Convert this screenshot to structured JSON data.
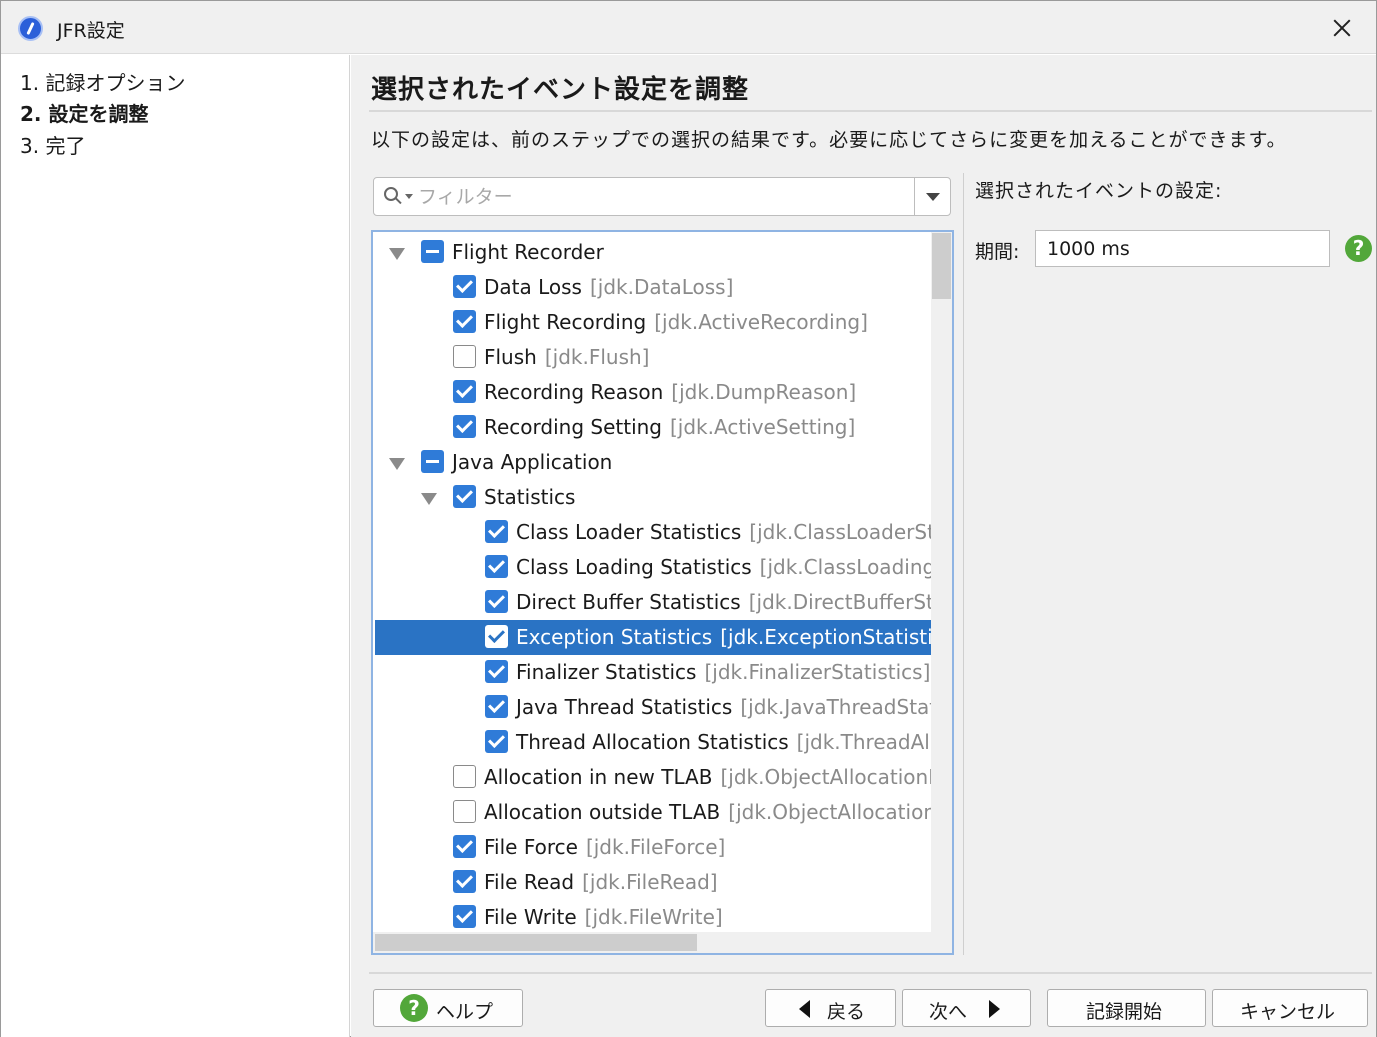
{
  "window": {
    "title": "JFR設定"
  },
  "steps": [
    {
      "label": "1. 記録オプション",
      "active": false
    },
    {
      "label": "2. 設定を調整",
      "active": true
    },
    {
      "label": "3. 完了",
      "active": false
    }
  ],
  "main": {
    "heading": "選択されたイベント設定を調整",
    "description": "以下の設定は、前のステップでの選択の結果です。必要に応じてさらに変更を加えることができます。"
  },
  "filter": {
    "placeholder": "フィルター",
    "value": ""
  },
  "tree": {
    "rows": [
      {
        "label": "Flight Recorder",
        "id": "",
        "level": 0,
        "expandable": true,
        "state": "partial",
        "selected": false
      },
      {
        "label": "Data Loss",
        "id": "[jdk.DataLoss]",
        "level": 1,
        "expandable": false,
        "state": "checked",
        "selected": false
      },
      {
        "label": "Flight Recording",
        "id": "[jdk.ActiveRecording]",
        "level": 1,
        "expandable": false,
        "state": "checked",
        "selected": false
      },
      {
        "label": "Flush",
        "id": "[jdk.Flush]",
        "level": 1,
        "expandable": false,
        "state": "unchecked",
        "selected": false
      },
      {
        "label": "Recording Reason",
        "id": "[jdk.DumpReason]",
        "level": 1,
        "expandable": false,
        "state": "checked",
        "selected": false
      },
      {
        "label": "Recording Setting",
        "id": "[jdk.ActiveSetting]",
        "level": 1,
        "expandable": false,
        "state": "checked",
        "selected": false
      },
      {
        "label": "Java Application",
        "id": "",
        "level": 0,
        "expandable": true,
        "state": "partial",
        "selected": false
      },
      {
        "label": "Statistics",
        "id": "",
        "level": 1,
        "expandable": true,
        "state": "checked",
        "selected": false
      },
      {
        "label": "Class Loader Statistics",
        "id": "[jdk.ClassLoaderStatistics]",
        "level": 2,
        "expandable": false,
        "state": "checked",
        "selected": false
      },
      {
        "label": "Class Loading Statistics",
        "id": "[jdk.ClassLoadingStatistics]",
        "level": 2,
        "expandable": false,
        "state": "checked",
        "selected": false
      },
      {
        "label": "Direct Buffer Statistics",
        "id": "[jdk.DirectBufferStatistics]",
        "level": 2,
        "expandable": false,
        "state": "checked",
        "selected": false
      },
      {
        "label": "Exception Statistics",
        "id": "[jdk.ExceptionStatistics]",
        "level": 2,
        "expandable": false,
        "state": "checked",
        "selected": true
      },
      {
        "label": "Finalizer Statistics",
        "id": "[jdk.FinalizerStatistics]",
        "level": 2,
        "expandable": false,
        "state": "checked",
        "selected": false
      },
      {
        "label": "Java Thread Statistics",
        "id": "[jdk.JavaThreadStatistics]",
        "level": 2,
        "expandable": false,
        "state": "checked",
        "selected": false
      },
      {
        "label": "Thread Allocation Statistics",
        "id": "[jdk.ThreadAllocationStatistics]",
        "level": 2,
        "expandable": false,
        "state": "checked",
        "selected": false
      },
      {
        "label": "Allocation in new TLAB",
        "id": "[jdk.ObjectAllocationInNewTLAB]",
        "level": 1,
        "expandable": false,
        "state": "unchecked",
        "selected": false
      },
      {
        "label": "Allocation outside TLAB",
        "id": "[jdk.ObjectAllocationOutsideTLAB]",
        "level": 1,
        "expandable": false,
        "state": "unchecked",
        "selected": false
      },
      {
        "label": "File Force",
        "id": "[jdk.FileForce]",
        "level": 1,
        "expandable": false,
        "state": "checked",
        "selected": false
      },
      {
        "label": "File Read",
        "id": "[jdk.FileRead]",
        "level": 1,
        "expandable": false,
        "state": "checked",
        "selected": false
      },
      {
        "label": "File Write",
        "id": "[jdk.FileWrite]",
        "level": 1,
        "expandable": false,
        "state": "checked",
        "selected": false
      }
    ]
  },
  "settings": {
    "title": "選択されたイベントの設定:",
    "period_label": "期間:",
    "period_value": "1000 ms",
    "help_symbol": "?"
  },
  "buttons": {
    "help": "ヘルプ",
    "help_symbol": "?",
    "back": "戻る",
    "next": "次へ",
    "start": "記録開始",
    "cancel": "キャンセル"
  },
  "colors": {
    "accent": "#2f7bd8",
    "selection": "#2a73c4",
    "help_green": "#52a73a"
  }
}
